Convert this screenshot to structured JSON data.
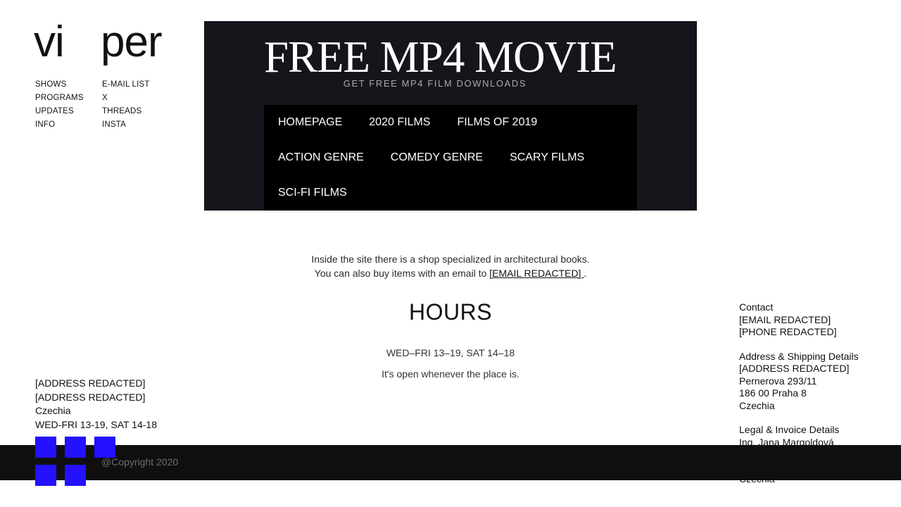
{
  "logo": {
    "part1": "vi",
    "part2": "per"
  },
  "nav": {
    "left": [
      "SHOWS",
      "PROGRAMS",
      "UPDATES",
      "INFO"
    ],
    "right": [
      "E-MAIL LIST",
      "X",
      "THREADS",
      "INSTA"
    ]
  },
  "banner": {
    "title": "FREE MP4 MOVIE",
    "subtitle": "GET FREE MP4 FILM DOWNLOADS",
    "menu": [
      [
        "HOMEPAGE",
        "2020 FILMS",
        "FILMS OF 2019"
      ],
      [
        "ACTION GENRE",
        "COMEDY GENRE",
        "SCARY FILMS"
      ],
      [
        "SCI-FI FILMS"
      ]
    ]
  },
  "info": {
    "line1": "Inside the site there is a shop specialized in architectural books.",
    "line2_prefix": "You can also buy items with an email to ",
    "email_link": "[EMAIL REDACTED] ",
    "line2_suffix": "."
  },
  "hours": {
    "title": "HOURS",
    "times": "WED–FRI 13–19, SAT 14–18",
    "note": "It's open whenever the place is."
  },
  "contact": {
    "heading": "Contact",
    "email": "[EMAIL REDACTED]",
    "phone": "[PHONE REDACTED]"
  },
  "shipping": {
    "heading": "Address & Shipping Details",
    "lines": [
      "[ADDRESS REDACTED]",
      "Pernerova 293/11",
      "186 00 Praha 8",
      "Czechia"
    ]
  },
  "legal": {
    "heading": "Legal & Invoice Details",
    "lines": [
      "Ing. Jana Margoldová",
      "[ADDRESS REDACTED]",
      "[ADDRESS REDACTED]",
      "Czechia"
    ]
  },
  "left_address": {
    "lines": [
      "[ADDRESS REDACTED]",
      "[ADDRESS REDACTED]",
      "Czechia",
      "WED-FRI 13-19, SAT 14-18"
    ]
  },
  "footer": {
    "copyright": "@Copyright 2020"
  },
  "colors": {
    "banner_bg": "#16151c",
    "menu_bg": "#000000",
    "social_blue": "#2311ff",
    "footer_bg": "#0f0f0f"
  }
}
